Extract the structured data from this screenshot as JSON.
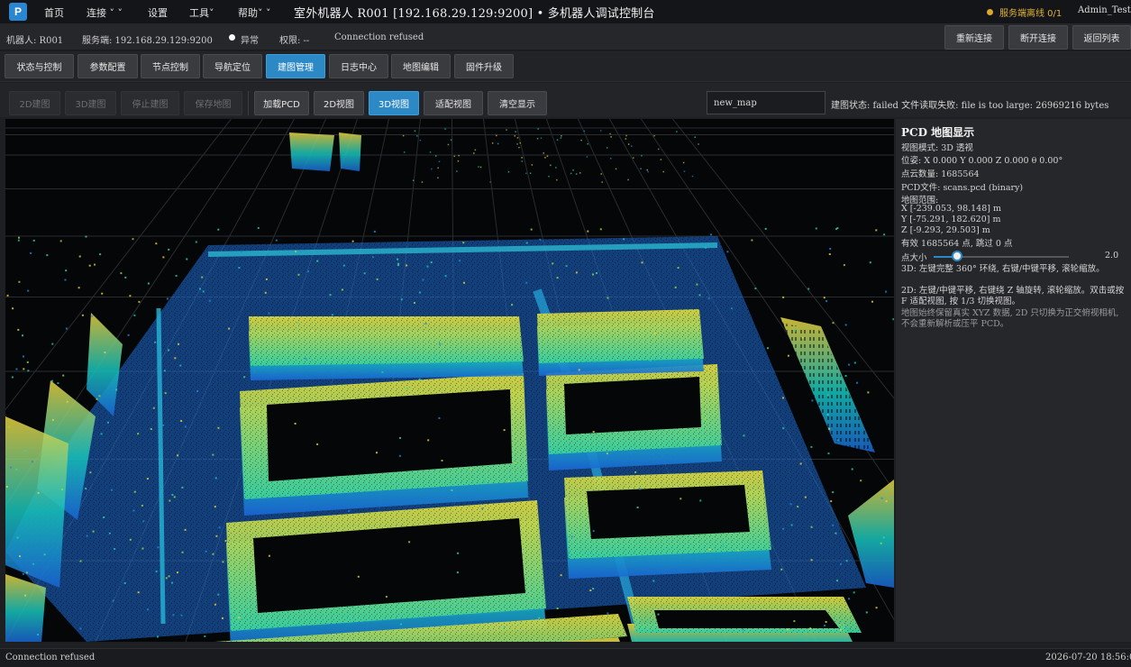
{
  "app": {
    "logo_glyph": "P",
    "title": "室外机器人 R001 [192.168.29.129:9200]  •  多机器人调试控制台",
    "menu": {
      "home": "首页",
      "connect": "连接",
      "settings": "设置",
      "tools": "工具",
      "help": "帮助"
    },
    "server_status": "服务端离线 0/1",
    "user": "Admin_Test"
  },
  "infobar": {
    "robot": "机器人: R001",
    "server": "服务端: 192.168.29.129:9200",
    "conn_state": "异常",
    "permission": "权限: --",
    "message": "Connection refused",
    "buttons": {
      "reconnect": "重新连接",
      "disconnect": "断开连接",
      "back": "返回列表"
    }
  },
  "tabs": [
    {
      "label": "状态与控制"
    },
    {
      "label": "参数配置"
    },
    {
      "label": "节点控制"
    },
    {
      "label": "导航定位"
    },
    {
      "label": "建图管理"
    },
    {
      "label": "日志中心"
    },
    {
      "label": "地图编辑"
    },
    {
      "label": "固件升级"
    }
  ],
  "active_tab": "建图管理",
  "toolbar": {
    "build_2d": "2D建图",
    "build_3d": "3D建图",
    "stop_build": "停止建图",
    "save_map": "保存地图",
    "load_pcd": "加载PCD",
    "view_2d": "2D视图",
    "view_3d": "3D视图",
    "fit_view": "适配视图",
    "clear_display": "清空显示",
    "map_name": "new_map",
    "build_status": "建图状态: failed 文件读取失败: file is too large: 26969216 bytes"
  },
  "panel": {
    "title": "PCD 地图显示",
    "view_mode": "视图模式: 3D 透视",
    "pose": "位姿: X 0.000  Y 0.000  Z 0.000  θ 0.00°",
    "point_count": "点云数量: 1685564",
    "pcd_file": "PCD文件: scans.pcd (binary)",
    "range_label": "地图范围:",
    "range_x": "X [-239.053, 98.148] m",
    "range_y": "Y [-75.291, 182.620] m",
    "range_z": "Z [-9.293, 29.503] m",
    "valid": "有效 1685564 点, 跳过 0 点",
    "point_size_label": "点大小",
    "point_size_value": "2.0",
    "point_size_fraction": 0.17,
    "help_3d": "3D: 左键完整 360° 环绕, 右键/中键平移, 滚轮缩放。",
    "help_2d": "2D: 左键/中键平移, 右键绕 Z 轴旋转, 滚轮缩放。双击或按 F 适配视图, 按 1/3 切换视图。",
    "note": "地图始终保留真实 XYZ 数据, 2D 只切换为正交俯视相机, 不会重新解析或压平 PCD。"
  },
  "statusbar": {
    "message": "Connection refused",
    "time": "2026-07-20 18:56:0"
  },
  "colors": {
    "accent": "#2c89c5",
    "warning": "#e0a62a",
    "pointcloud_low": "#1e6fd6",
    "pointcloud_mid": "#19c9b8",
    "pointcloud_high": "#f0d23a"
  }
}
